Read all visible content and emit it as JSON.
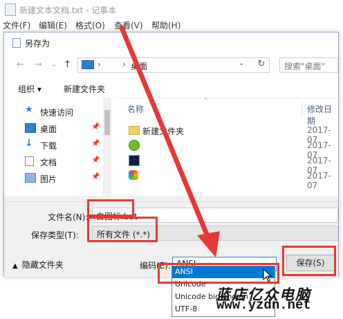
{
  "notepad": {
    "title": "新建文本文档.txt - 记事本",
    "menu": [
      "文件(F)",
      "编辑(E)",
      "格式(O)",
      "查看(V)",
      "帮助(H)"
    ]
  },
  "dialog": {
    "title": "另存为",
    "address": "桌面",
    "search_placeholder": "搜索\"桌面\"",
    "toolbar": {
      "organize": "组织 ▾",
      "new_folder": "新建文件夹"
    },
    "nav": [
      {
        "label": "快速访问",
        "icon": "star-icon"
      },
      {
        "label": "桌面",
        "icon": "desktop-icon"
      },
      {
        "label": "下载",
        "icon": "download-icon"
      },
      {
        "label": "文档",
        "icon": "document-icon"
      },
      {
        "label": "图片",
        "icon": "picture-icon"
      }
    ],
    "columns": {
      "name": "名称",
      "date": "修改日期"
    },
    "files": [
      {
        "name": "新建文件夹",
        "date": "2017-07",
        "icon": "folder-icon"
      },
      {
        "name": "",
        "date": "2017-07",
        "icon": "green-app-icon"
      },
      {
        "name": "",
        "date": "2017-07",
        "icon": "photoshop-icon"
      },
      {
        "name": "",
        "date": "2017-07",
        "icon": "colorful-app-icon"
      }
    ],
    "filename_label": "文件名(N):",
    "filename_value": "白图标.bat",
    "type_label": "保存类型(T):",
    "type_value": "所有文件  (*.*)",
    "hide_folders": "隐藏文件夹",
    "encoding_label": "编码(E):",
    "encoding_value": "ANSI",
    "save_button": "保存(S)",
    "encoding_options": [
      "ANSI",
      "Unicode",
      "Unicode big endian",
      "UTF-8"
    ]
  },
  "watermark": {
    "text": "蓝店亿众电脑",
    "url": "www.yzdn.net"
  },
  "colors": {
    "annotation_red": "#e53935",
    "selection_blue": "#0078d7"
  }
}
